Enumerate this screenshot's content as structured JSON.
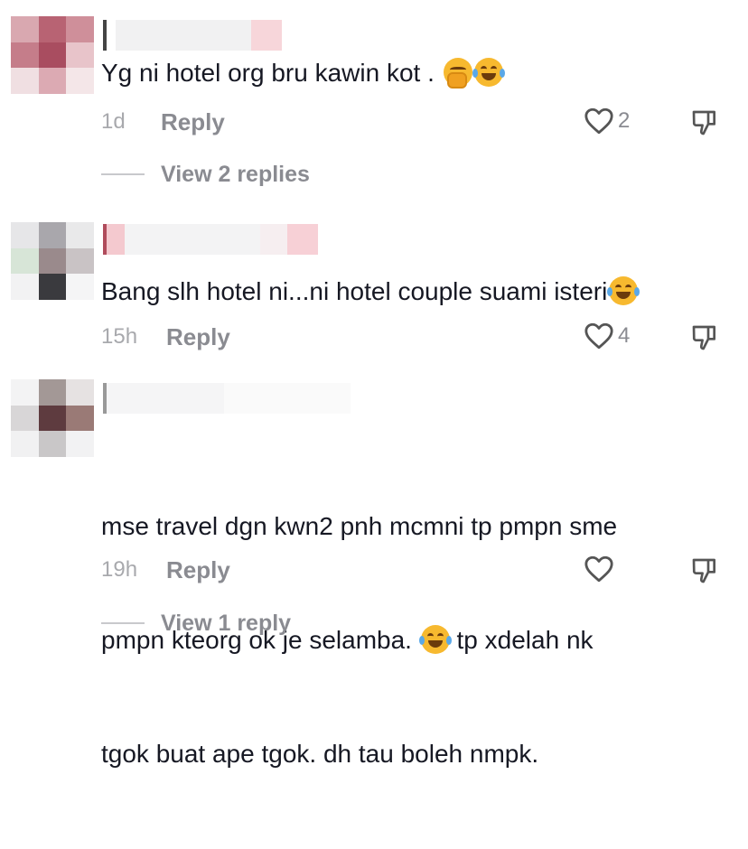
{
  "comments": [
    {
      "text": "Yg ni hotel org bru kawin kot . ",
      "time": "1d",
      "reply_label": "Reply",
      "likes": "2",
      "view_replies": "View 2 replies",
      "emoji": [
        "face-with-hand-over-mouth",
        "face-with-tears-of-joy"
      ]
    },
    {
      "text": "Bang slh hotel ni...ni hotel couple suami isteri",
      "time": "15h",
      "reply_label": "Reply",
      "likes": "4",
      "emoji": [
        "face-with-tears-of-joy"
      ]
    },
    {
      "text_line1": "mse travel dgn kwn2 pnh mcmni tp pmpn sme",
      "text_line2": "pmpn kteorg ok je selamba. ",
      "text_line2b": " tp xdelah nk",
      "text_line3": "tgok buat ape tgok. dh tau boleh nmpk.",
      "time": "19h",
      "reply_label": "Reply",
      "likes": "",
      "view_replies": "View 1 reply",
      "emoji": [
        "face-with-tears-of-joy"
      ]
    }
  ],
  "icons": {
    "like": "heart-outline-icon",
    "dislike": "thumbs-down-outline-icon"
  },
  "colors": {
    "text": "#161823",
    "muted": "#8a8b91",
    "time": "#a8a9ad"
  }
}
